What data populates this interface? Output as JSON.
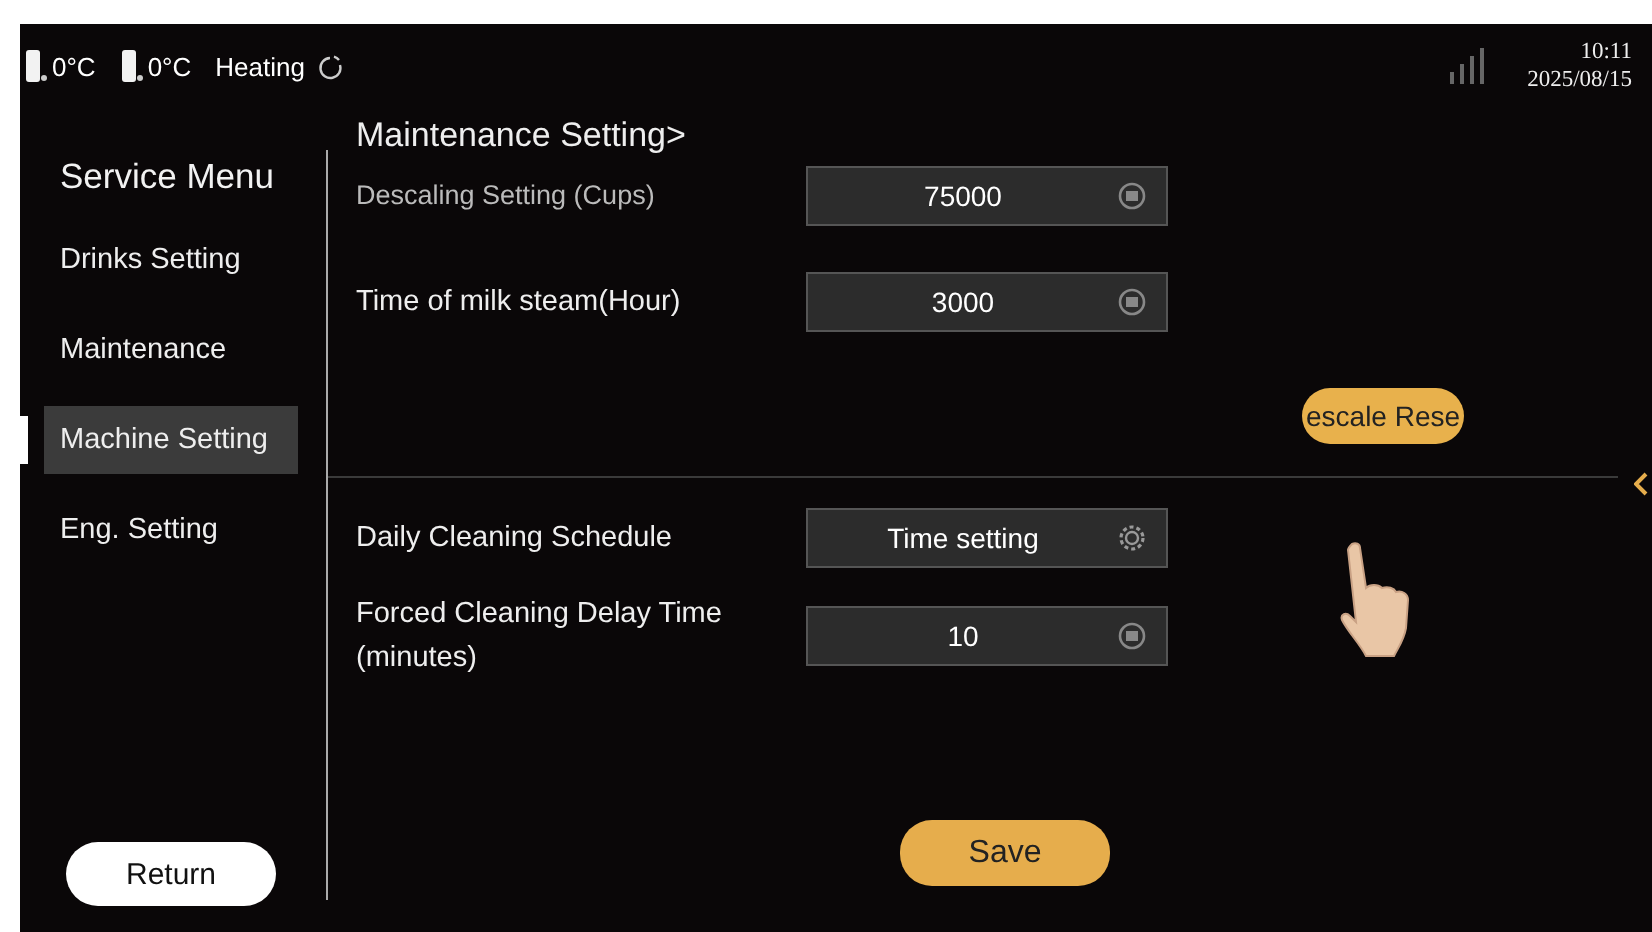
{
  "status_bar": {
    "sensors": [
      {
        "reading": "0°C"
      },
      {
        "reading": "0°C"
      }
    ],
    "status": "Heating",
    "time": "10:11",
    "date": "2025/08/15"
  },
  "sidebar": {
    "title": "Service Menu",
    "items": [
      {
        "label": "Drinks Setting",
        "selected": false
      },
      {
        "label": "Maintenance",
        "selected": false
      },
      {
        "label": "Machine Setting",
        "selected": true
      },
      {
        "label": "Eng. Setting",
        "selected": false
      }
    ],
    "return_button": "Return"
  },
  "content": {
    "breadcrumb": "Maintenance Setting>",
    "sections": [
      {
        "rows": [
          {
            "label": "Descaling Setting (Cups)",
            "value": "75000",
            "kind": "number"
          },
          {
            "label": "Time of milk steam(Hour)",
            "value": "3000",
            "kind": "number"
          }
        ],
        "action_button": "escale Rese"
      },
      {
        "rows": [
          {
            "label": "Daily Cleaning Schedule",
            "value": "Time setting",
            "kind": "schedule"
          },
          {
            "label": "Forced Cleaning Delay Time (minutes)",
            "value": "10",
            "kind": "number"
          }
        ]
      }
    ],
    "save_button": "Save"
  }
}
